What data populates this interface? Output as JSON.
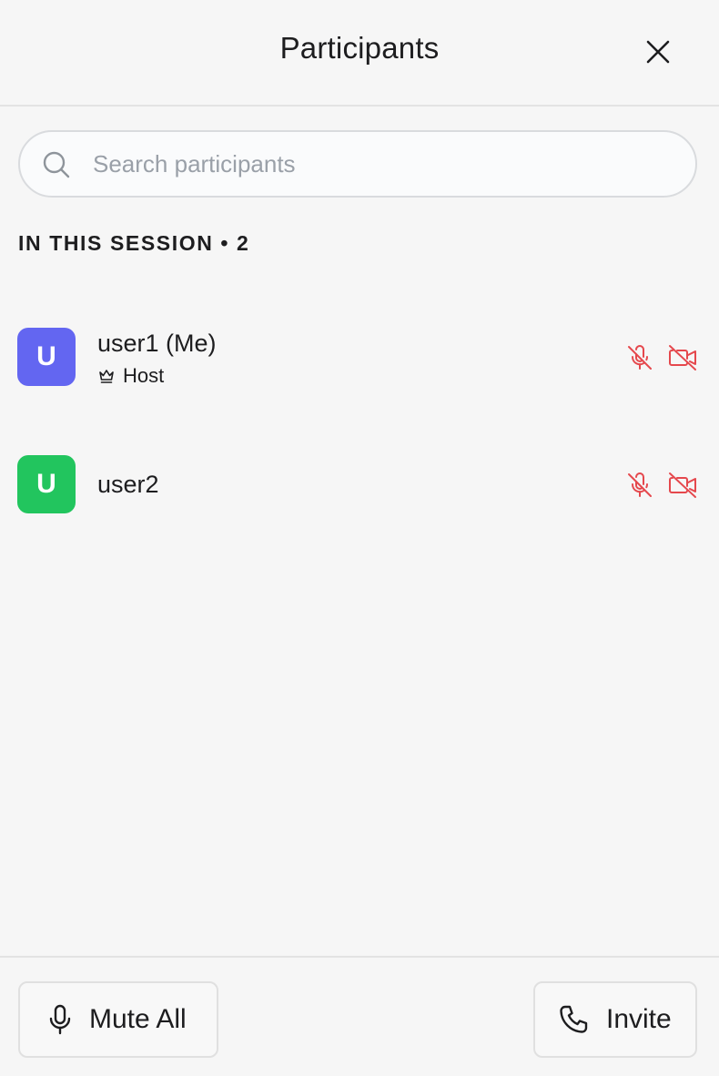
{
  "header": {
    "title": "Participants",
    "close_icon": "close-icon"
  },
  "search": {
    "placeholder": "Search participants",
    "value": "",
    "icon": "search-icon"
  },
  "section": {
    "label": "IN THIS SESSION • 2"
  },
  "participants": [
    {
      "initial": "U",
      "name": "user1 (Me)",
      "role": "Host",
      "role_icon": "crown-icon",
      "avatar_color": "#6366f1",
      "mic_icon": "mic-off-icon",
      "camera_icon": "video-off-icon"
    },
    {
      "initial": "U",
      "name": "user2",
      "avatar_color": "#22c55e",
      "mic_icon": "mic-off-icon",
      "camera_icon": "video-off-icon"
    }
  ],
  "footer": {
    "mute_all_label": "Mute All",
    "mute_all_icon": "mic-icon",
    "invite_label": "Invite",
    "invite_icon": "phone-icon"
  },
  "colors": {
    "muted_status": "#e5484d",
    "background": "#f6f6f6",
    "divider": "#e3e3e3"
  }
}
